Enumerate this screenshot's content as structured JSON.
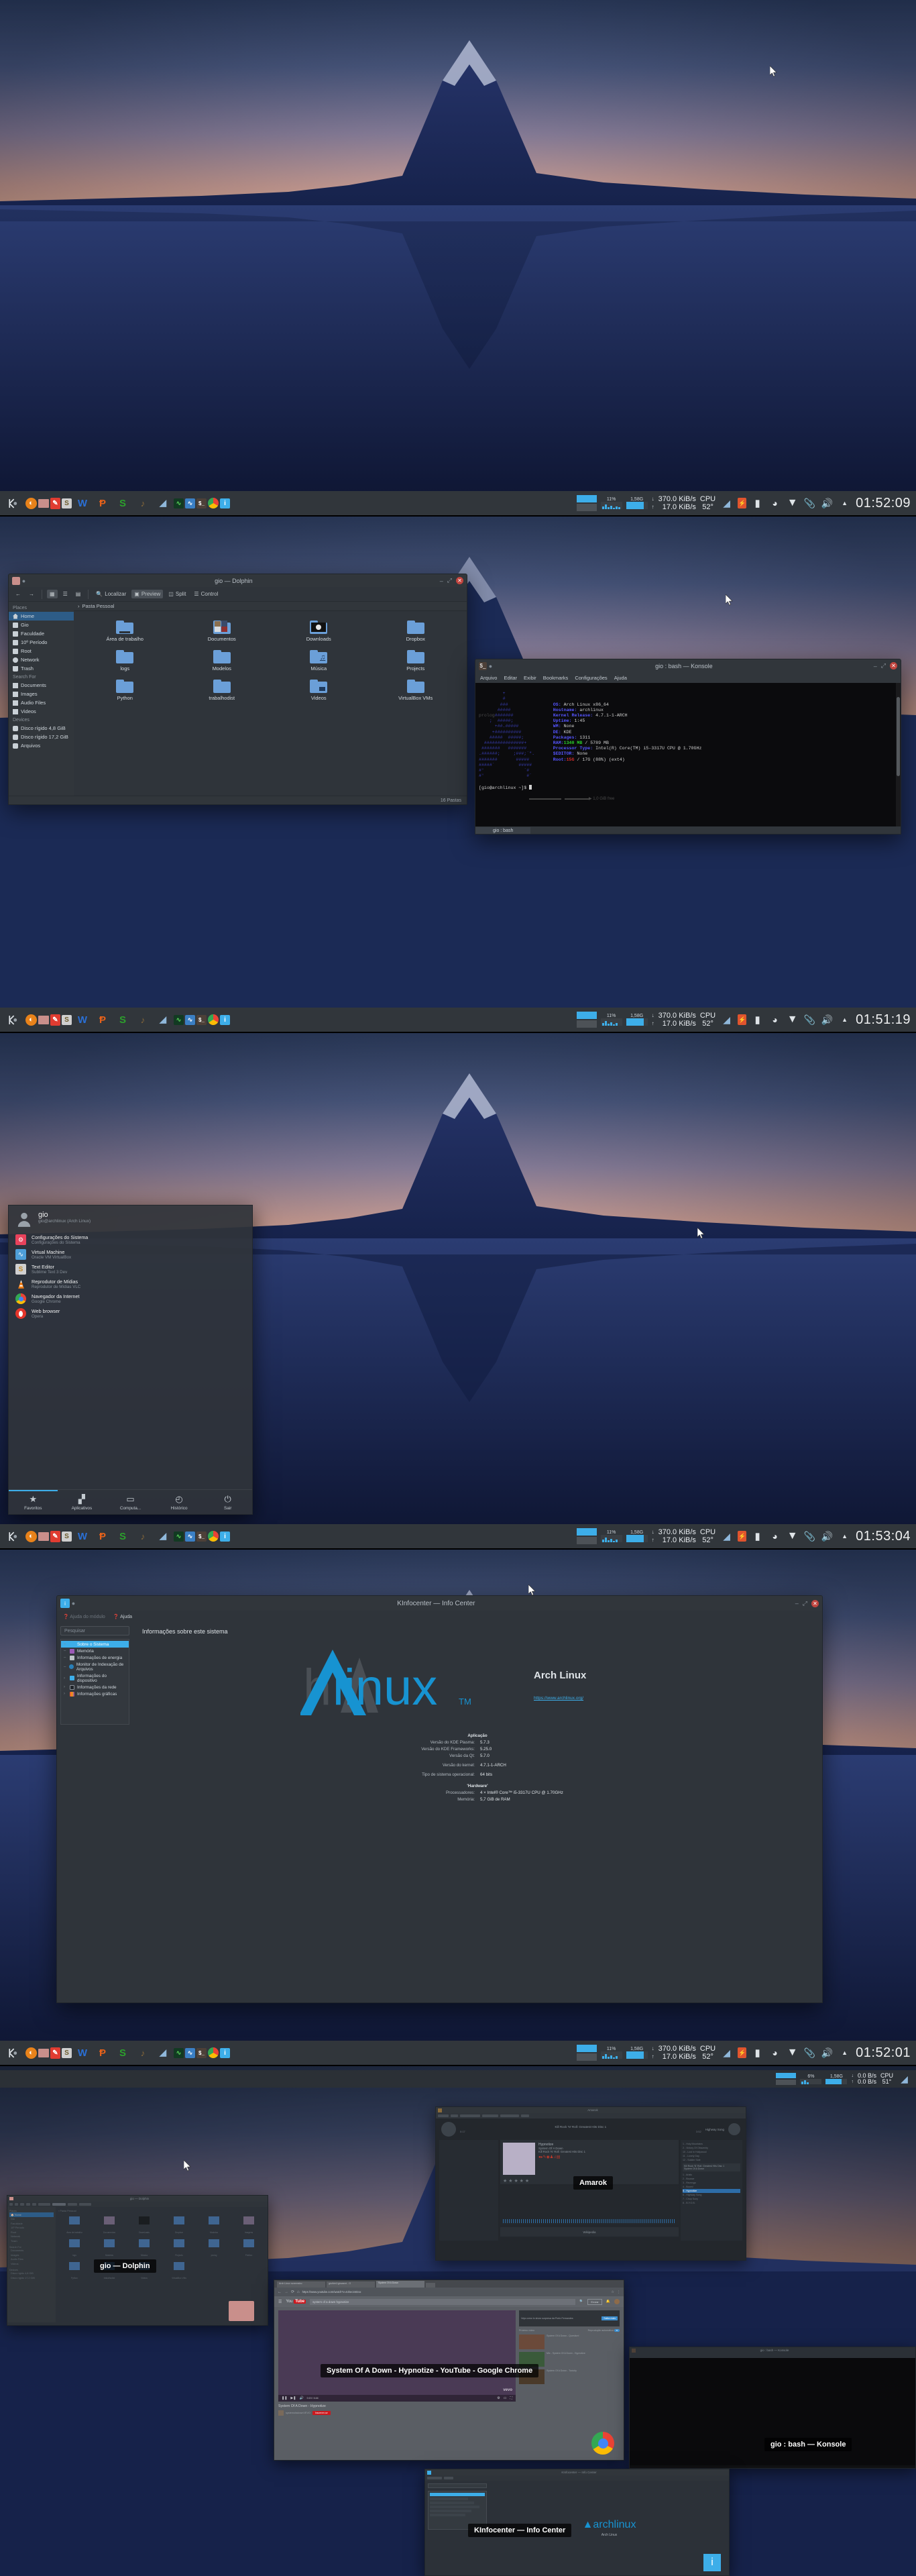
{
  "desktop": {
    "os_name": "Arch Linux",
    "wallpaper_name": "mount-fuji-sunset"
  },
  "panel": {
    "kmenu_label": "K",
    "task_icons": [
      {
        "name": "firefox-icon",
        "glyph": "◐",
        "color": "#e8821a"
      },
      {
        "name": "dolphin-icon",
        "glyph": "■",
        "color": "#c98f8b"
      },
      {
        "name": "sublime-text-icon",
        "glyph": "✎",
        "color": "#e03c31"
      },
      {
        "name": "sublime-text-dev-icon",
        "glyph": "S",
        "color": "#cfcfcf"
      },
      {
        "name": "wps-writer-icon",
        "glyph": "W",
        "color": "#2a6fd4"
      },
      {
        "name": "wps-presentation-icon",
        "glyph": "P",
        "color": "#e8621a"
      },
      {
        "name": "wps-spreadsheet-icon",
        "glyph": "S",
        "color": "#2ca02c"
      },
      {
        "name": "amarok-icon",
        "glyph": "♪",
        "color": "#8a6a3a"
      },
      {
        "name": "krita-icon",
        "glyph": "◢",
        "color": "#8fb7da"
      },
      {
        "name": "system-monitor-icon",
        "glyph": "⤳",
        "color": "#1f5c3a"
      },
      {
        "name": "virtualbox-icon",
        "glyph": "⤳",
        "color": "#3b7fc4"
      },
      {
        "name": "konsole-icon",
        "glyph": "$_",
        "color": "#4d4038"
      },
      {
        "name": "google-chrome-icon",
        "glyph": "●",
        "color": "#f2c500"
      },
      {
        "name": "kinfocenter-icon",
        "glyph": "i",
        "color": "#3daee9"
      }
    ],
    "tray": {
      "mem_percent": "11%",
      "mem_total": "1,58G",
      "net_down": "370.0 KiB/s",
      "net_up": "17.0 KiB/s",
      "cpu_label": "CPU",
      "cpu_temp": "52°",
      "icons": [
        {
          "name": "krita-tray-icon",
          "glyph": "◢"
        },
        {
          "name": "battery-tray-icon",
          "glyph": "⚡"
        },
        {
          "name": "device-notifier-icon",
          "glyph": "▮"
        },
        {
          "name": "clipboard-tray-icon",
          "glyph": "◔"
        },
        {
          "name": "network-tray-icon",
          "glyph": "▼"
        },
        {
          "name": "klipper-tray-icon",
          "glyph": "📎"
        },
        {
          "name": "volume-tray-icon",
          "glyph": "🔊"
        },
        {
          "name": "show-hidden-tray-icon",
          "glyph": "▲"
        }
      ]
    },
    "clocks": {
      "shot1": "01:52:09",
      "shot2": "01:51:19",
      "shot3": "01:53:04",
      "shot4": "01:52:01"
    },
    "amarok_shot": {
      "mem_percent": "6%",
      "mem_total": "1,58G",
      "net_down": "0.0 B/s",
      "net_up": "0.0 B/s",
      "cpu_label": "CPU",
      "cpu_temp": "51°"
    }
  },
  "dolphin": {
    "title": "gio — Dolphin",
    "toolbar": {
      "back": "←",
      "forward": "→",
      "view_icons": "icons-view",
      "view_compact": "compact-view",
      "view_details": "details-view",
      "find_label": "Localizar",
      "preview_label": "Preview",
      "split_label": "Split",
      "control_label": "Control"
    },
    "breadcrumb": "Pasta Pessoal",
    "sidebar": [
      {
        "group": "Places",
        "items": [
          {
            "label": "Home",
            "icon": "home-icon",
            "selected": true
          },
          {
            "label": "Gio",
            "icon": "folder-icon",
            "selected": false
          },
          {
            "label": "Faculdade",
            "icon": "folder-icon",
            "selected": false
          },
          {
            "label": "10º Período",
            "icon": "folder-icon",
            "selected": false
          },
          {
            "label": "Root",
            "icon": "folder-icon",
            "selected": false
          },
          {
            "label": "Network",
            "icon": "network-icon",
            "selected": false
          },
          {
            "label": "Trash",
            "icon": "trash-icon",
            "selected": false
          }
        ]
      },
      {
        "group": "Search For",
        "items": [
          {
            "label": "Documents",
            "icon": "document-icon",
            "selected": false
          },
          {
            "label": "Images",
            "icon": "image-icon",
            "selected": false
          },
          {
            "label": "Audio Files",
            "icon": "audio-icon",
            "selected": false
          },
          {
            "label": "Videos",
            "icon": "video-icon",
            "selected": false
          }
        ]
      },
      {
        "group": "Devices",
        "items": [
          {
            "label": "Disco rígido 4,8 GiB",
            "icon": "disk-icon",
            "selected": false
          },
          {
            "label": "Disco rígido 17,2 GiB",
            "icon": "disk-icon",
            "selected": false
          },
          {
            "label": "Arquivos",
            "icon": "disk-icon",
            "selected": false
          }
        ]
      }
    ],
    "folders": [
      {
        "label": "Área de trabalho",
        "type": "desktop"
      },
      {
        "label": "Documentos",
        "type": "photos"
      },
      {
        "label": "Downloads",
        "type": "dark"
      },
      {
        "label": "Dropbox",
        "type": "plain"
      },
      {
        "label": "logs",
        "type": "plain"
      },
      {
        "label": "Modelos",
        "type": "plain"
      },
      {
        "label": "Música",
        "type": "music"
      },
      {
        "label": "Projects",
        "type": "plain"
      },
      {
        "label": "Python",
        "type": "plain"
      },
      {
        "label": "trabalhodist",
        "type": "plain"
      },
      {
        "label": "Videos",
        "type": "video"
      },
      {
        "label": "VirtualBox VMs",
        "type": "plain"
      }
    ],
    "status": "16 Pastas"
  },
  "konsole": {
    "title": "gio : bash — Konsole",
    "menu": [
      "Arquivo",
      "Editar",
      "Exibir",
      "Bookmarks",
      "Configurações",
      "Ajuda"
    ],
    "tab_label": "gio : bash",
    "screenfetch": [
      {
        "key": "OS:",
        "value": " Arch Linux x86_64"
      },
      {
        "key": "Hostname:",
        "value": " archlinux"
      },
      {
        "key": "Kernel Release:",
        "value": " 4.7.1-1-ARCH"
      },
      {
        "key": "Uptime:",
        "value": " 1:45"
      },
      {
        "key": "WM:",
        "value": " None"
      },
      {
        "key": "DE:",
        "value": " KDE"
      },
      {
        "key": "Packages:",
        "value": " 1311"
      },
      {
        "key": "RAM:",
        "value": " 1340 MB / 5789 MB"
      },
      {
        "key": "Processor Type:",
        "value": " Intel(R) Core(TM) i5-3317U CPU @ 1.70GHz"
      },
      {
        "key": "$EDITOR:",
        "value": " None"
      },
      {
        "key": "Root:",
        "value": " 15G / 17G (88%) (ext4)"
      }
    ],
    "ram_used": "1340 MB",
    "ram_total": " / 5789 MB",
    "root_used": "15G",
    "root_rest": " / 17G (88%) (ext4)",
    "prompt": "[gio@archlinux ~]$ ",
    "free_space": "1,0 GiB free"
  },
  "kickoff": {
    "user_name": "gio",
    "user_sub": "gio@archlinux (Arch Linux)",
    "favorites": [
      {
        "title": "Configurações do Sistema",
        "sub": "Configurações do Sistema",
        "icon": "systemsettings-icon"
      },
      {
        "title": "Virtual Machine",
        "sub": "Oracle VM VirtualBox",
        "icon": "virtualbox-icon"
      },
      {
        "title": "Text Editor",
        "sub": "Sublime Text 3 Dev",
        "icon": "sublime-icon"
      },
      {
        "title": "Reprodutor de Mídias",
        "sub": "Reprodutor de Mídias VLC",
        "icon": "vlc-icon"
      },
      {
        "title": "Navegador da Internet",
        "sub": "Google Chrome",
        "icon": "chrome-icon"
      },
      {
        "title": "Web browser",
        "sub": "Opera",
        "icon": "opera-icon"
      }
    ],
    "tabs": [
      {
        "label": "Favoritos",
        "icon": "star-icon",
        "selected": true
      },
      {
        "label": "Aplicativos",
        "icon": "grid-icon",
        "selected": false
      },
      {
        "label": "Computa...",
        "icon": "computer-icon",
        "selected": false
      },
      {
        "label": "Histórico",
        "icon": "clock-icon",
        "selected": false
      },
      {
        "label": "Sair",
        "icon": "leave-icon",
        "selected": false
      }
    ]
  },
  "kinfocenter": {
    "title": "KInfocenter — Info Center",
    "menu": [
      {
        "label": "Ajuda do módulo",
        "disabled": true
      },
      {
        "label": "Ajuda",
        "disabled": false
      }
    ],
    "search_placeholder": "Pesquisar",
    "tree": [
      {
        "label": "Sobre o Sistema",
        "color": "#3daee9",
        "selected": true,
        "expandable": false
      },
      {
        "label": "Memória",
        "color": "#9b59b6",
        "selected": false,
        "expandable": false
      },
      {
        "label": "Informações de energia",
        "color": "#bdc3c7",
        "selected": false,
        "expandable": false
      },
      {
        "label": "Monitor de Indexação de Arquivos",
        "color": "#2980b9",
        "selected": false,
        "expandable": false
      },
      {
        "label": "Informações do dispositivo",
        "color": "#3daee9",
        "selected": false,
        "expandable": true
      },
      {
        "label": "Informações da rede",
        "color": "#2c3136",
        "selected": false,
        "expandable": true
      },
      {
        "label": "Informações gráficas",
        "color": "#e74c3c",
        "selected": false,
        "expandable": true
      }
    ],
    "heading": "Informações sobre este sistema",
    "distro_name": "Arch Linux",
    "distro_url": "https://www.archlinux.org/",
    "logo_text": "archlinux",
    "logo_tm": "TM",
    "sections": [
      {
        "title": "Aplicação",
        "rows": [
          {
            "k": "Versão do KDE Plasma:",
            "v": "5.7.3"
          },
          {
            "k": "Versão do KDE Frameworks:",
            "v": "5.25.0"
          },
          {
            "k": "Versão da Qt:",
            "v": "5.7.0"
          },
          {
            "k": "Versão do kernel:",
            "v": "4.7.1-1-ARCH"
          },
          {
            "k": "Tipo de sistema operacional:",
            "v": "64 bits"
          }
        ]
      },
      {
        "title": "'Hardware'",
        "rows": [
          {
            "k": "Processadores:",
            "v": "4 × Intel® Core™ i5-3317U CPU @ 1.70GHz"
          },
          {
            "k": "Memória:",
            "v": "5,7 GiB de RAM"
          }
        ]
      }
    ]
  },
  "present_windows": {
    "captions": [
      {
        "label": "Amarok",
        "name": "amarok-window-caption"
      },
      {
        "label": "gio — Dolphin",
        "name": "dolphin-window-caption"
      },
      {
        "label": "System Of A Down - Hypnotize - YouTube - Google Chrome",
        "name": "chrome-window-caption"
      },
      {
        "label": "gio : bash — Konsole",
        "name": "konsole-window-caption"
      },
      {
        "label": "KInfocenter — Info Center",
        "name": "kinfocenter-window-caption"
      }
    ],
    "chrome": {
      "url": "https://www.youtube.com/watch?v=tohec34tzxx",
      "search_value": "system of a down hypnotize",
      "brand": "You Tube",
      "video_title": "System Of A Down - Hypnotize",
      "channel": "systemofadownVEVO",
      "tabs": [
        "Arch Linux screensho",
        "gio/kbr1/giovanni - O",
        "System Of A Down"
      ],
      "sidebar_items": [
        "System Of A Down - Question!",
        "Mix - System Of A Down - Hypnotize",
        "System Of A Down - Toxicity"
      ],
      "autoplay_label": "Reprodução automática",
      "next_label": "Próximo vídeo"
    },
    "amarok": {
      "album": "Kill Rock 'N' Roll: Greatest Hits  Disc 1",
      "track": "Hypnotize",
      "artist": "System Of A Down",
      "next_label": "Highway Song",
      "time_elapsed": "0:17",
      "time_total": "3:52",
      "menu": [
        "Amarok",
        "Lista",
        "Ordenar músicas",
        "Ferramentas",
        "Configurações",
        "Ajuda"
      ],
      "playlist_selected": "5 - Hypnotize"
    },
    "kinfocenter_mini": {
      "title": "KInfocenter — Info Center",
      "distro": "Arch Linux"
    }
  }
}
